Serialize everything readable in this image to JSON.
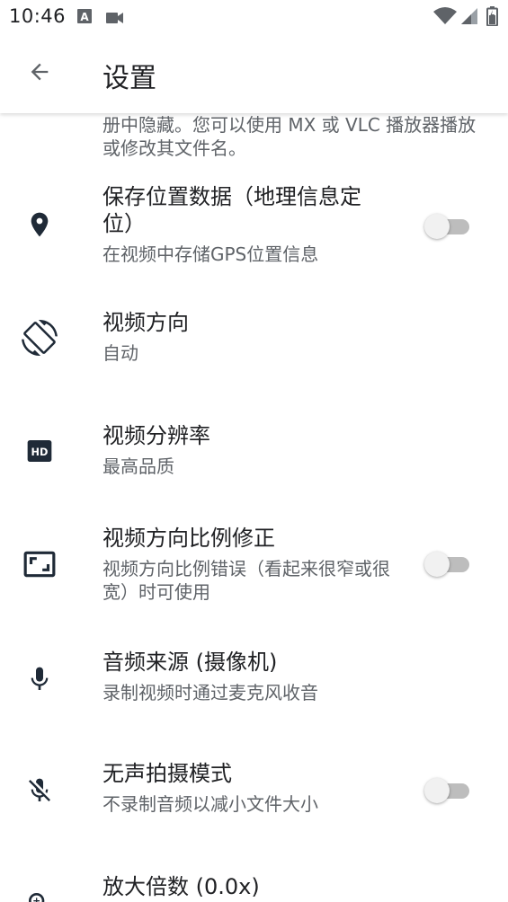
{
  "status_bar": {
    "time": "10:46",
    "icons": [
      "notification-a-icon",
      "video-camera-icon",
      "wifi-icon",
      "signal-icon",
      "battery-icon"
    ]
  },
  "app_bar": {
    "title": "设置",
    "back_icon": "arrow-back-icon"
  },
  "prev_item": {
    "summary_tail": "册中隐藏。您可以使用 MX 或 VLC 播放器播放或修改其文件名。"
  },
  "settings": [
    {
      "icon": "location-pin-icon",
      "title": "保存位置数据（地理信息定位）",
      "summary": "在视频中存储GPS位置信息",
      "switch_on": false
    },
    {
      "icon": "screen-rotation-icon",
      "title": "视频方向",
      "summary": "自动"
    },
    {
      "icon": "hd-icon",
      "title": "视频分辨率",
      "summary": "最高品质"
    },
    {
      "icon": "aspect-ratio-icon",
      "title": "视频方向比例修正",
      "summary": "视频方向比例错误（看起来很窄或很宽）时可使用",
      "switch_on": false
    },
    {
      "icon": "microphone-icon",
      "title": "音频来源 (摄像机)",
      "summary": "录制视频时通过麦克风收音"
    },
    {
      "icon": "microphone-off-icon",
      "title": "无声拍摄模式",
      "summary": "不录制音频以减小文件大小",
      "switch_on": false
    },
    {
      "icon": "zoom-in-icon",
      "title": "放大倍数 (0.0x)"
    }
  ],
  "colors": {
    "text_primary": "#202124",
    "text_secondary": "#5f6368",
    "icon": "#1f2a37",
    "switch_track_off": "#bdbdbd",
    "switch_thumb_off": "#f1f1f1"
  }
}
